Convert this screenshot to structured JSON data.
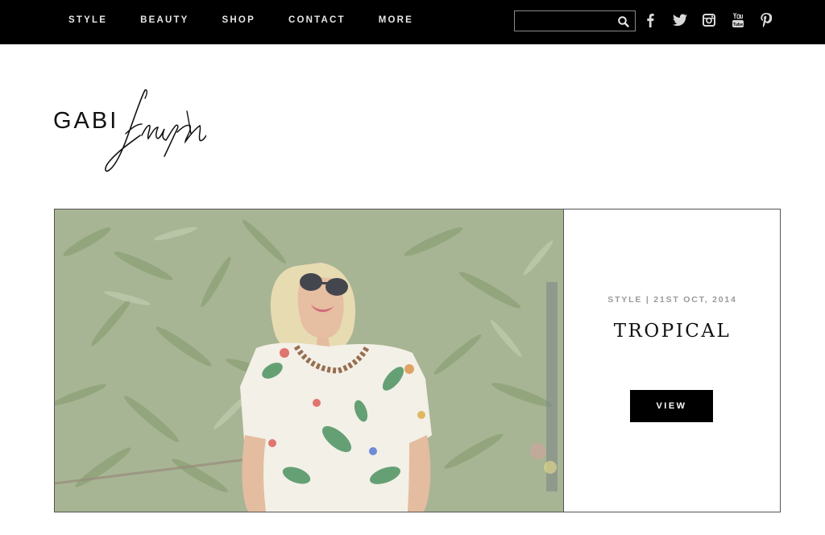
{
  "nav": {
    "items": [
      {
        "label": "STYLE"
      },
      {
        "label": "BEAUTY"
      },
      {
        "label": "SHOP"
      },
      {
        "label": "CONTACT"
      },
      {
        "label": "MORE"
      }
    ]
  },
  "search": {
    "value": "",
    "placeholder": ""
  },
  "social": [
    "facebook-icon",
    "twitter-icon",
    "instagram-icon",
    "youtube-icon",
    "pinterest-icon"
  ],
  "logo": {
    "text": "GABI",
    "script_text": "fresh"
  },
  "featured_post": {
    "meta": "STYLE | 21ST OCT, 2014",
    "title": "TROPICAL",
    "button_label": "VIEW"
  },
  "colors": {
    "nav_background": "#000000",
    "page_background": "#ffffff",
    "meta_text": "#9a9a9a",
    "button_background": "#000000"
  }
}
